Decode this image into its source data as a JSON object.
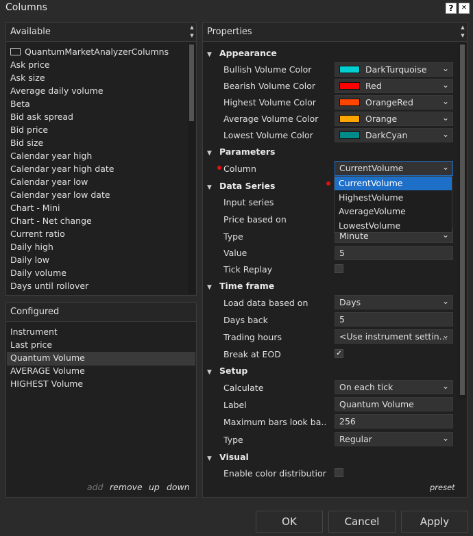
{
  "window": {
    "title": "Columns",
    "help_label": "?",
    "close_label": "✕"
  },
  "available": {
    "header": "Available",
    "folder": "QuantumMarketAnalyzerColumns",
    "items": [
      "Ask price",
      "Ask size",
      "Average daily volume",
      "Beta",
      "Bid ask spread",
      "Bid price",
      "Bid size",
      "Calendar year high",
      "Calendar year high date",
      "Calendar year low",
      "Calendar year low date",
      "Chart - Mini",
      "Chart - Net change",
      "Current ratio",
      "Daily high",
      "Daily low",
      "Daily volume",
      "Days until rollover"
    ]
  },
  "configured": {
    "header": "Configured",
    "items": [
      "Instrument",
      "Last price",
      "Quantum Volume",
      "AVERAGE Volume",
      "HIGHEST Volume"
    ],
    "selected_index": 2,
    "links": {
      "add": "add",
      "remove": "remove",
      "up": "up",
      "down": "down"
    }
  },
  "properties": {
    "header": "Properties",
    "categories": {
      "appearance": "Appearance",
      "parameters": "Parameters",
      "data_series": "Data Series",
      "time_frame": "Time frame",
      "setup": "Setup",
      "visual": "Visual"
    },
    "appearance": [
      {
        "label": "Bullish Volume Color",
        "value": "DarkTurquoise",
        "color": "#00ced1"
      },
      {
        "label": "Bearish Volume Color",
        "value": "Red",
        "color": "#ff0000"
      },
      {
        "label": "Highest Volume Color",
        "value": "OrangeRed",
        "color": "#ff4500"
      },
      {
        "label": "Average Volume Color",
        "value": "Orange",
        "color": "#ffa500"
      },
      {
        "label": "Lowest Volume Color",
        "value": "DarkCyan",
        "color": "#008b8b"
      }
    ],
    "parameters": {
      "column_label": "Column",
      "column_value": "CurrentVolume"
    },
    "data_series": {
      "input_series_label": "Input series",
      "price_based_on_label": "Price based on",
      "type_label": "Type",
      "type_value": "Minute",
      "value_label": "Value",
      "value_value": "5",
      "tick_replay_label": "Tick Replay",
      "tick_replay_checked": false
    },
    "time_frame": {
      "load_label": "Load data based on",
      "load_value": "Days",
      "days_back_label": "Days back",
      "days_back_value": "5",
      "trading_hours_label": "Trading hours",
      "trading_hours_value": "<Use instrument settin...",
      "break_eod_label": "Break at EOD",
      "break_eod_checked": true
    },
    "setup": {
      "calculate_label": "Calculate",
      "calculate_value": "On each tick",
      "label_label": "Label",
      "label_value": "Quantum Volume",
      "max_bars_label": "Maximum bars look ba...",
      "max_bars_value": "256",
      "type_label": "Type",
      "type_value": "Regular"
    },
    "visual": {
      "enable_color_label": "Enable color distribution",
      "enable_color_checked": false
    },
    "preset_link": "preset"
  },
  "column_dropdown": {
    "options": [
      "CurrentVolume",
      "HighestVolume",
      "AverageVolume",
      "LowestVolume"
    ],
    "selected_index": 0
  },
  "buttons": {
    "ok": "OK",
    "cancel": "Cancel",
    "apply": "Apply"
  },
  "colors": {
    "accent": "#1e6fc8",
    "required_dot": "#e01010"
  }
}
